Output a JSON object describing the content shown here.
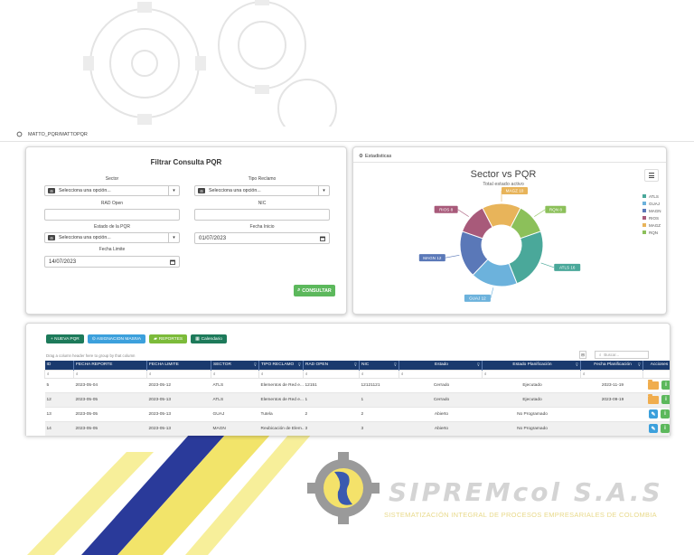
{
  "breadcrumb": {
    "path": "MATTO_PQR/MATTOPQR"
  },
  "filter": {
    "title": "Filtrar Consulta PQR",
    "sector_label": "Sector",
    "sector_value": "Selecciona una opción...",
    "tipo_label": "Tipo Reclamo",
    "tipo_value": "Selecciona una opción...",
    "rad_label": "RAD Open",
    "rad_value": "",
    "nic_label": "NIC",
    "nic_value": "",
    "estado_label": "Estado de la PQR",
    "estado_value": "Selecciona una opción...",
    "fecha_inicio_label": "Fecha Inicio",
    "fecha_inicio_value": "01/07/2023",
    "fecha_limite_label": "Fecha Limite",
    "fecha_limite_value": "14/07/2023",
    "select_badge": "⊞",
    "consultar_label": "CONSULTAR"
  },
  "stats": {
    "header": "Estadisticas",
    "chart_data": {
      "type": "pie",
      "title": "Sector vs PQR",
      "subtitle": "Total estado activo",
      "categories": [
        "ATLS",
        "GUAJ",
        "MAGN",
        "RIOS",
        "MAGZ",
        "RQN"
      ],
      "values": [
        16,
        12,
        12,
        8,
        10,
        8
      ],
      "data_labels": [
        "ATLS 16",
        "GUAJ 12",
        "MAGN 12",
        "RIOS 8",
        "MAGZ 10",
        "RQN 8"
      ],
      "colors": [
        "#4aa89a",
        "#6cb2dc",
        "#5a78b8",
        "#a85a7a",
        "#e8b45a",
        "#8cc05a"
      ],
      "legend_position": "right"
    }
  },
  "toolbar": {
    "nueva_label": "+ NUEVA PQR",
    "asignacion_label": "⊙ ASIGNACION MASIVA",
    "reportes_label": "REPORTES",
    "calendario_label": "Calendario"
  },
  "grid": {
    "drag_hint": "Drag a column header here to group by that column",
    "search_placeholder": "Buscar...",
    "columns": [
      "ID",
      "FECHA REPORTE",
      "FECHA LIMITE",
      "SECTOR",
      "TIPO RECLAMO",
      "RAD OPEN",
      "NIC",
      "Estado",
      "Estado Planificación",
      "Fecha Planificación",
      "Acciones"
    ],
    "rows": [
      [
        "5",
        "2023-05-04",
        "2023-05-12",
        "ATLS",
        "Elementos de Red e...",
        "12151",
        "12121121",
        "Cerrado",
        "Ejecutado",
        "2023-11-19"
      ],
      [
        "12",
        "2023-05-05",
        "2023-05-13",
        "ATLS",
        "Elementos de Red e...",
        "1",
        "1",
        "Cerrado",
        "Ejecutado",
        "2023-09-19"
      ],
      [
        "13",
        "2023-05-05",
        "2023-05-13",
        "GUAJ",
        "Tutela",
        "2",
        "2",
        "Abierto",
        "No Programado",
        ""
      ],
      [
        "14",
        "2023-05-05",
        "2023-05-13",
        "MAGN",
        "Reubicación de Elem...",
        "3",
        "3",
        "Abierto",
        "No Programado",
        ""
      ]
    ]
  },
  "logo": {
    "name": "SIPREMcol S.A.S",
    "tagline": "SISTEMATIZACIÓN INTEGRAL DE PROCESOS EMPRESARIALES DE COLOMBIA"
  }
}
